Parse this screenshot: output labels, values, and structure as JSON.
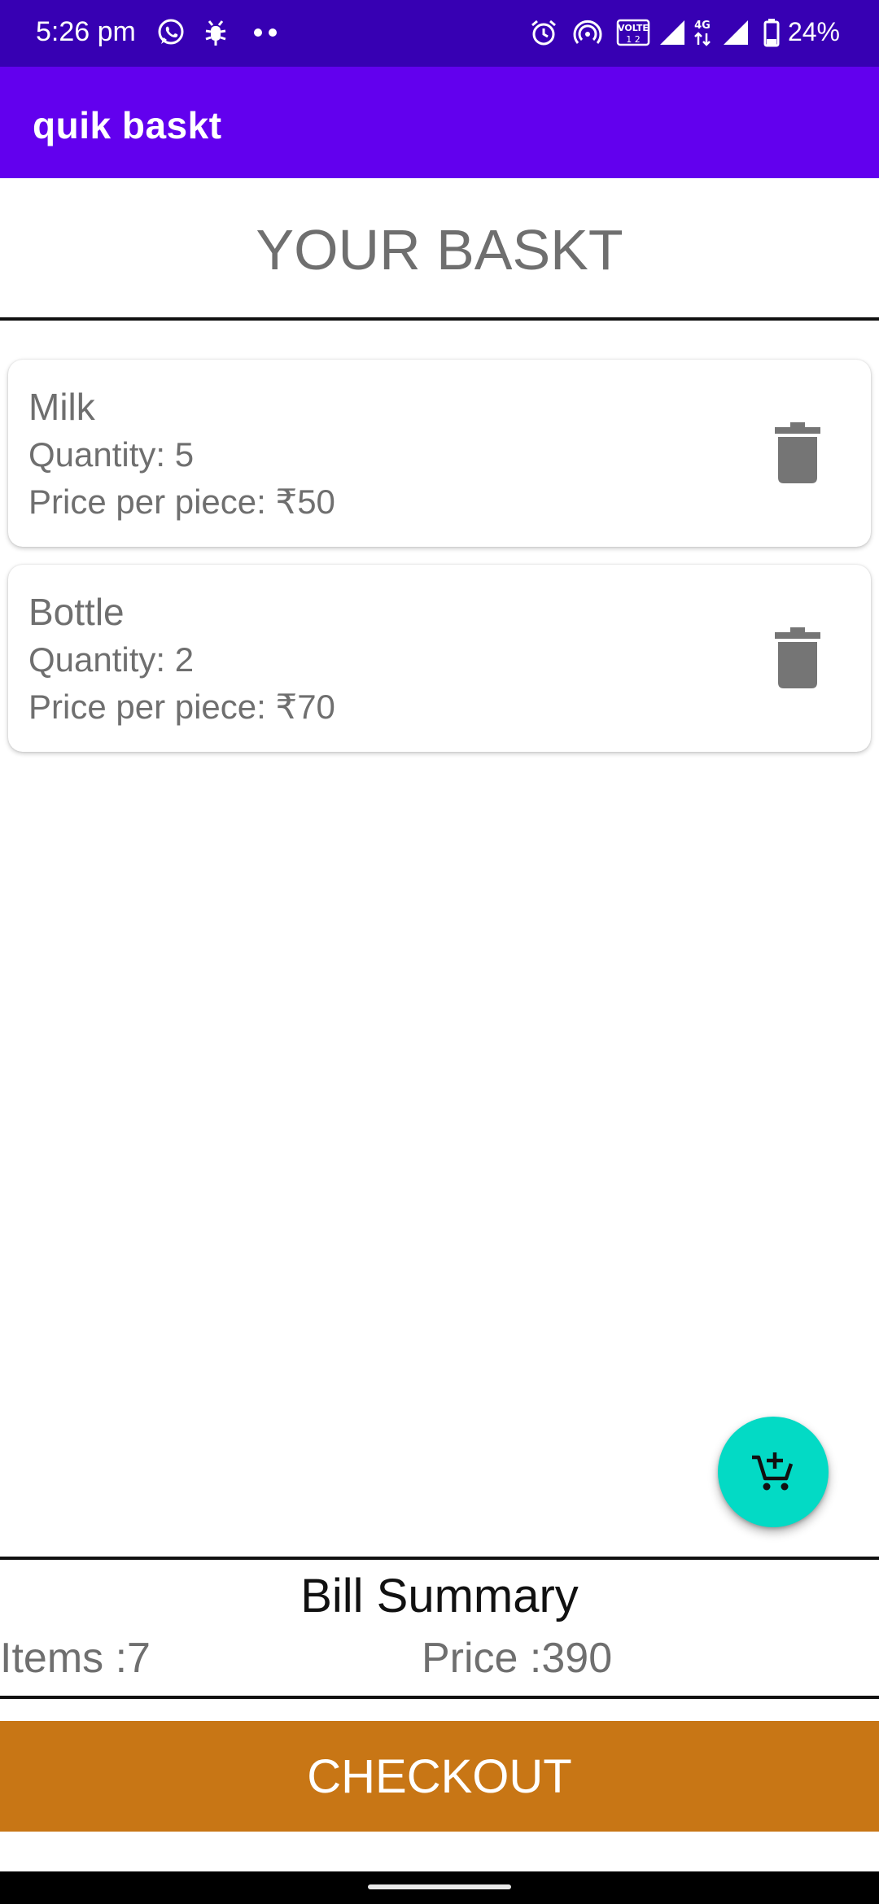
{
  "status_bar": {
    "time": "5:26 pm",
    "battery": "24%",
    "icons": [
      "whatsapp-icon",
      "bug-icon",
      "dots-icon",
      "alarm-icon",
      "hotspot-icon",
      "volte-icon",
      "signal-icon",
      "4g-icon",
      "signal-icon",
      "battery-icon"
    ],
    "volte_label": "VOLTE",
    "volte_sub": "1 2",
    "network_label": "4G"
  },
  "app_bar": {
    "title": "quik baskt"
  },
  "page": {
    "heading": "YOUR BASKT"
  },
  "basket": {
    "items": [
      {
        "name": "Milk",
        "quantity": "Quantity: 5",
        "price": "Price per piece: ₹50",
        "delete_icon": "trash-icon"
      },
      {
        "name": "Bottle",
        "quantity": "Quantity: 2",
        "price": "Price per piece: ₹70",
        "delete_icon": "trash-icon"
      }
    ]
  },
  "fab": {
    "icon": "add-to-cart-icon"
  },
  "bill": {
    "title": "Bill Summary",
    "items": "Items :7",
    "price": "Price :390"
  },
  "checkout": {
    "label": "CHECKOUT"
  },
  "colors": {
    "status_bar": "#3700b3",
    "app_bar": "#6200ee",
    "fab": "#03dac5",
    "checkout": "#c87615",
    "text_gray": "#6f6f6f"
  }
}
